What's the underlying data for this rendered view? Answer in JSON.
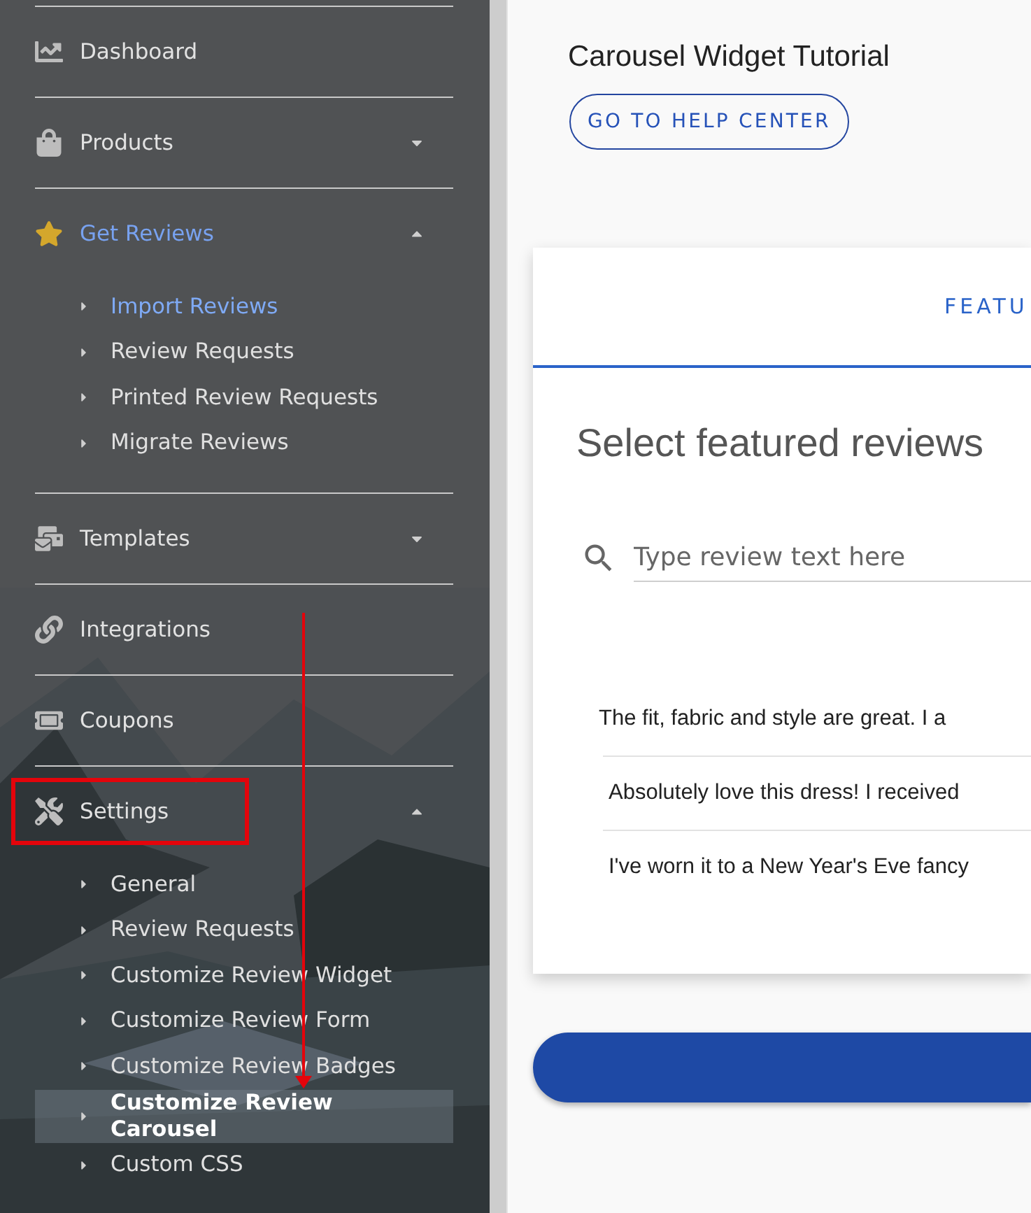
{
  "sidebar": {
    "sections": [
      {
        "label": "Dashboard",
        "active": false
      },
      {
        "label": "Products",
        "active": false,
        "expanded": false
      },
      {
        "label": "Get Reviews",
        "active": true,
        "expanded": true,
        "items": [
          {
            "label": "Import Reviews",
            "active": true,
            "selected": false
          },
          {
            "label": "Review Requests",
            "active": false,
            "selected": false
          },
          {
            "label": "Printed Review Requests",
            "active": false,
            "selected": false
          },
          {
            "label": "Migrate Reviews",
            "active": false,
            "selected": false
          }
        ]
      },
      {
        "label": "Templates",
        "active": false,
        "expanded": false
      },
      {
        "label": "Integrations",
        "active": false
      },
      {
        "label": "Coupons",
        "active": false
      },
      {
        "label": "Settings",
        "active": false,
        "expanded": true,
        "items": [
          {
            "label": "General",
            "active": false,
            "selected": false
          },
          {
            "label": "Review Requests",
            "active": false,
            "selected": false
          },
          {
            "label": "Customize Review Widget",
            "active": false,
            "selected": false
          },
          {
            "label": "Customize Review Form",
            "active": false,
            "selected": false
          },
          {
            "label": "Customize Review Badges",
            "active": false,
            "selected": false
          },
          {
            "label": "Customize Review Carousel",
            "active": false,
            "selected": true
          },
          {
            "label": "Custom CSS",
            "active": false,
            "selected": false
          }
        ]
      }
    ]
  },
  "annotations": [
    {
      "kind": "frame"
    },
    {
      "kind": "arrow"
    }
  ],
  "main": {
    "title": "Carousel Widget Tutorial",
    "help_button": "GO TO HELP CENTER",
    "card": {
      "tabs": [
        {
          "label": "FEATU",
          "selected": true
        }
      ],
      "heading": "Select featured reviews",
      "search": {
        "placeholder": "Type review text here"
      },
      "reviews": [
        "The fit, fabric and style are great. I a",
        "Absolutely love this dress! I received",
        "I've worn it to a New Year's Eve fancy"
      ]
    }
  }
}
